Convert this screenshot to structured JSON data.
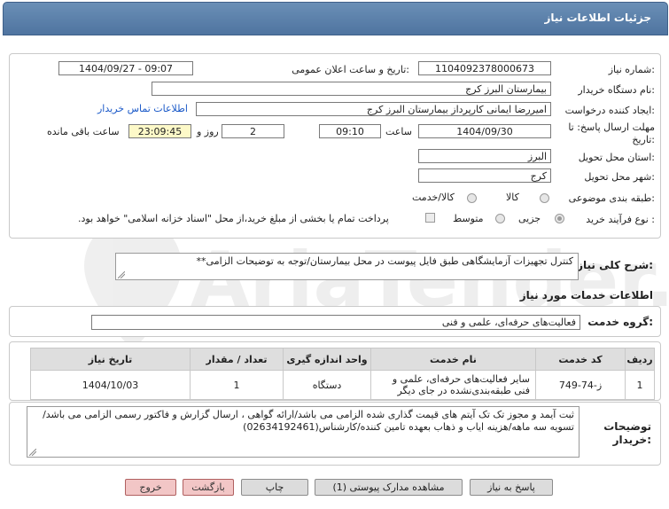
{
  "header": {
    "title": "جزئیات اطلاعات نیاز"
  },
  "form": {
    "need_number_label": "شماره نیاز:",
    "need_number": "1104092378000673",
    "announce_label": "تاریخ و ساعت اعلان عمومی:",
    "announce_value": "1404/09/27 - 09:07",
    "buyer_org_label": "نام دستگاه خریدار:",
    "buyer_org": "بیمارستان البرز کرج",
    "requester_label": "ایجاد کننده درخواست:",
    "requester": "امیررضا ایمانی کارپرداز بیمارستان البرز کرج",
    "contact_link": "اطلاعات تماس خریدار",
    "deadline_label_1": "مهلت ارسال پاسخ: تا",
    "deadline_label_2": "تاریخ:",
    "deadline_date": "1404/09/30",
    "hour_label": "ساعت",
    "deadline_time": "09:10",
    "days_value": "2",
    "days_label": "روز و",
    "remaining_time": "23:09:45",
    "remaining_label": "ساعت باقی مانده",
    "province_label": "استان محل تحویل:",
    "province": "البرز",
    "city_label": "شهر محل تحویل:",
    "city": "کرج",
    "category_label": "طبقه بندی موضوعی:",
    "category_options": [
      "کالا",
      "کالا/خدمت"
    ],
    "process_label": "نوع فرآیند خرید :",
    "process_options": [
      "جزیی",
      "متوسط"
    ],
    "payment_note": "پرداخت تمام یا بخشی از مبلغ خرید،از محل \"اسناد خزانه اسلامی\" خواهد بود."
  },
  "need": {
    "summary_label": "شرح کلی نیاز:",
    "summary": "کنترل تجهیزات آزمایشگاهی طبق فایل پیوست در محل بیمارستان/توجه به توضیحات الزامی**",
    "services_heading": "اطلاعات خدمات مورد نیاز",
    "group_label": "گروه خدمت:",
    "group": "فعالیت‌های حرفه‌ای، علمی و فنی"
  },
  "table": {
    "headers": [
      "ردیف",
      "کد خدمت",
      "نام خدمت",
      "واحد اندازه گیری",
      "تعداد / مقدار",
      "تاریخ نیاز"
    ],
    "rows": [
      {
        "row": "1",
        "code": "ز-74-749",
        "name": "سایر فعالیت‌های حرفه‌ای، علمی و فنی طبقه‌بندی‌نشده در جای دیگر",
        "unit": "دستگاه",
        "qty": "1",
        "date": "1404/10/03"
      }
    ]
  },
  "notes": {
    "label_1": "توضیحات",
    "label_2": "خریدار:",
    "text": "ثبت آیمد و مجوز تک تک آیتم های قیمت گذاری شده الزامی می باشد/ارائه گواهی ، ارسال گزارش و فاکتور رسمی الزامی می باشد/تسویه سه ماهه/هزینه ایاب و ذهاب بعهده تامین کننده/کارشناس(02634192461)"
  },
  "buttons": {
    "reply": "پاسخ به نیاز",
    "attachments": "مشاهده مدارک پیوستی (1)",
    "print": "چاپ",
    "back": "بازگشت",
    "exit": "خروج"
  },
  "colors": {
    "title_bar": "#5a7eaa",
    "link": "#1a59c8",
    "highlight": "#fdf9c8",
    "exit_button": "#f2c6c6"
  }
}
